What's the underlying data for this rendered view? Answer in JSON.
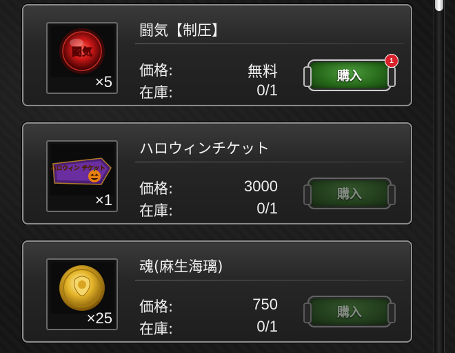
{
  "labels": {
    "price": "価格:",
    "stock": "在庫:",
    "buy": "購入"
  },
  "items": [
    {
      "name": "闘気【制圧】",
      "quantity": "×5",
      "price": "無料",
      "stock": "0/1",
      "buy_enabled": true,
      "badge": "1",
      "icon": "red-fighting-spirit-orb-icon",
      "icon_text": "闘気"
    },
    {
      "name": "ハロウィンチケット",
      "quantity": "×1",
      "price": "3000",
      "stock": "0/1",
      "buy_enabled": false,
      "icon": "halloween-ticket-icon",
      "icon_text": "ハロウィン チケット"
    },
    {
      "name": "魂(麻生海璃)",
      "quantity": "×25",
      "price": "750",
      "stock": "0/1",
      "buy_enabled": false,
      "icon": "gold-soul-coin-icon"
    }
  ],
  "colors": {
    "buy_green": "#276a1b",
    "badge_red": "#d8212a",
    "card_border": "#8e8e8e"
  }
}
